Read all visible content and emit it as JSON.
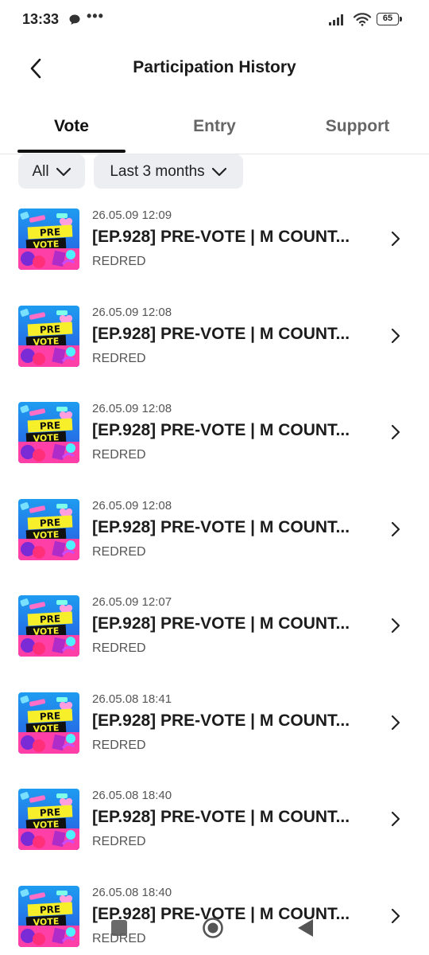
{
  "status_bar": {
    "time": "13:33",
    "dots": "•••",
    "battery": "65"
  },
  "header": {
    "title": "Participation History"
  },
  "tabs": [
    {
      "label": "Vote",
      "active": true
    },
    {
      "label": "Entry",
      "active": false
    },
    {
      "label": "Support",
      "active": false
    }
  ],
  "filters": {
    "type": "All",
    "period": "Last 3 months"
  },
  "thumbnail": {
    "line1": "PRE",
    "line2": "VOTE"
  },
  "items": [
    {
      "date": "26.05.09 12:09",
      "title": "[EP.928] PRE-VOTE | M COUNT...",
      "artist": "REDRED"
    },
    {
      "date": "26.05.09 12:08",
      "title": "[EP.928] PRE-VOTE | M COUNT...",
      "artist": "REDRED"
    },
    {
      "date": "26.05.09 12:08",
      "title": "[EP.928] PRE-VOTE | M COUNT...",
      "artist": "REDRED"
    },
    {
      "date": "26.05.09 12:08",
      "title": "[EP.928] PRE-VOTE | M COUNT...",
      "artist": "REDRED"
    },
    {
      "date": "26.05.09 12:07",
      "title": "[EP.928] PRE-VOTE | M COUNT...",
      "artist": "REDRED"
    },
    {
      "date": "26.05.08 18:41",
      "title": "[EP.928] PRE-VOTE | M COUNT...",
      "artist": "REDRED"
    },
    {
      "date": "26.05.08 18:40",
      "title": "[EP.928] PRE-VOTE | M COUNT...",
      "artist": "REDRED"
    },
    {
      "date": "26.05.08 18:40",
      "title": "[EP.928] PRE-VOTE | M COUNT...",
      "artist": "REDRED"
    }
  ]
}
